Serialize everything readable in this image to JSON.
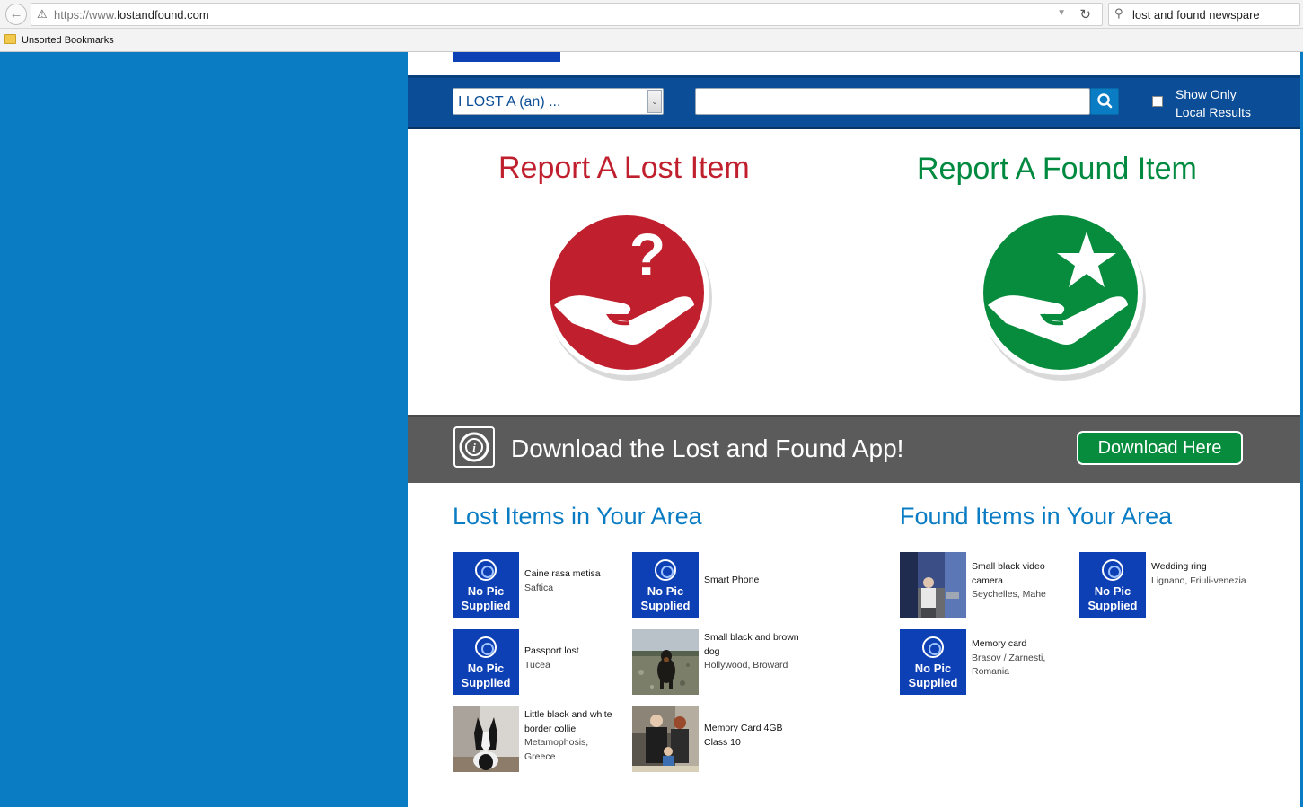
{
  "browser": {
    "url_scheme": "https://www.",
    "url_host": "lostandfound.com",
    "search_query": "lost and found newspare",
    "bookmarks_folder": "Unsorted Bookmarks"
  },
  "searchbar": {
    "category_select": "I LOST A (an) ...",
    "query_value": "",
    "local_label_line1": "Show Only",
    "local_label_line2": "Local Results"
  },
  "report": {
    "lost_title": "Report A Lost Item",
    "found_title": "Report A Found Item"
  },
  "app_band": {
    "text": "Download the Lost and Found App!",
    "button": "Download Here"
  },
  "lost_area": {
    "title": "Lost Items in Your Area",
    "items": [
      {
        "name": "Caine rasa metisa",
        "location": "Saftica",
        "thumb": "nopic"
      },
      {
        "name": "Smart Phone",
        "location": "",
        "thumb": "nopic"
      },
      {
        "name": "Passport lost",
        "location": "Tucea",
        "thumb": "nopic"
      },
      {
        "name": "Small black and brown dog",
        "location": "Hollywood, Broward",
        "thumb": "photo"
      },
      {
        "name": "Little black and white border collie",
        "location": "Metamophosis, Greece",
        "thumb": "photo"
      },
      {
        "name": "Memory Card 4GB Class 10",
        "location": "",
        "thumb": "photo"
      }
    ]
  },
  "found_area": {
    "title": "Found Items in Your Area",
    "items": [
      {
        "name": "Small black video camera",
        "location": "Seychelles, Mahe",
        "thumb": "photo"
      },
      {
        "name": "Wedding ring",
        "location": "Lignano, Friuli-venezia",
        "thumb": "nopic"
      },
      {
        "name": "Memory card",
        "location": "Brasov / Zarnesti, Romania",
        "thumb": "nopic"
      }
    ]
  },
  "nopic_line1": "No Pic",
  "nopic_line2": "Supplied",
  "colors": {
    "lost_red": "#c01f2d",
    "found_green": "#008a40",
    "brand_blue": "#0a7cc3",
    "band_blue": "#0b4d96",
    "nopic_blue": "#0d3fb5"
  }
}
